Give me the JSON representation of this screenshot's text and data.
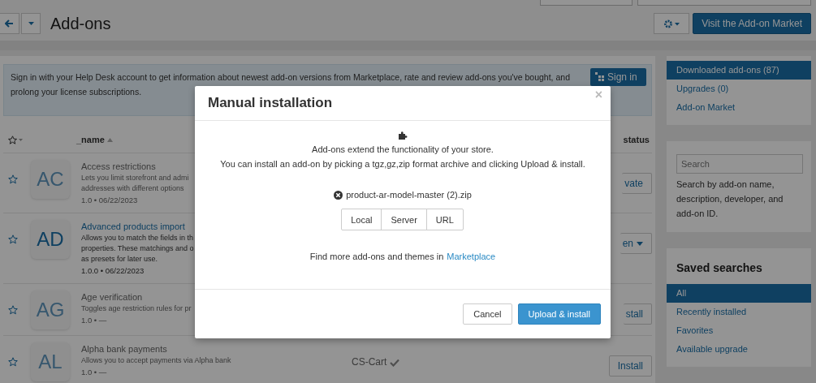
{
  "page": {
    "title": "Add-ons",
    "market_button": "Visit the Add-on Market"
  },
  "notice": {
    "text": "Sign in with your Help Desk account to get information about newest add-on versions from Marketplace, rate and review add-ons you've bought, and prolong your license subscriptions.",
    "button": "Sign in"
  },
  "table": {
    "columns": [
      "_name",
      "status"
    ],
    "rows": [
      {
        "initials": "AC",
        "name": "Access restrictions",
        "enabled": false,
        "description": [
          "Lets you limit storefront and admi",
          "addresses with different options"
        ],
        "meta": "1.0 • 06/22/2023",
        "action": "vate",
        "action_menu": false
      },
      {
        "initials": "AD",
        "name": "Advanced products import",
        "enabled": true,
        "description": [
          "Allows you to match the fields in th",
          "properties. These matchings and o",
          "as presets for later use."
        ],
        "meta": "1.0.0 • 06/22/2023",
        "action": "en",
        "action_menu": true
      },
      {
        "initials": "AG",
        "name": "Age verification",
        "enabled": false,
        "description": [
          "Toggles age restriction rules for pr"
        ],
        "meta": "1.0 • —",
        "action": "stall",
        "action_menu": false
      },
      {
        "initials": "AL",
        "name": "Alpha bank payments",
        "enabled": false,
        "description": [
          "Allows you to accept payments via Alpha bank"
        ],
        "meta": "1.0 • —",
        "developer": "CS-Cart",
        "action": "Install",
        "action_menu": false
      }
    ]
  },
  "sidebar": {
    "views": [
      {
        "label": "Downloaded add-ons (87)",
        "selected": true
      },
      {
        "label": "Upgrades (0)",
        "selected": false
      },
      {
        "label": "Add-on Market",
        "selected": false
      }
    ],
    "search": {
      "placeholder": "Search",
      "help": "Search by add-on name, description, developer, and add-on ID."
    },
    "saved_searches": {
      "title": "Saved searches",
      "items": [
        {
          "label": "All",
          "selected": true
        },
        {
          "label": "Recently installed",
          "selected": false
        },
        {
          "label": "Favorites",
          "selected": false
        },
        {
          "label": "Available upgrade",
          "selected": false
        }
      ]
    }
  },
  "dialog": {
    "title": "Manual installation",
    "close": "×",
    "intro": [
      "Add-ons extend the functionality of your store.",
      "You can install an add-on by picking a tgz,gz,zip format archive and clicking Upload & install."
    ],
    "file": "product-ar-model-master (2).zip",
    "sources": [
      {
        "label": "Local",
        "selected": false
      },
      {
        "label": "Server",
        "selected": false
      },
      {
        "label": "URL",
        "selected": false
      }
    ],
    "more_text": "Find more add-ons and themes in",
    "more_link": "Marketplace",
    "buttons": [
      {
        "label": "Cancel",
        "kind": "secondary"
      },
      {
        "label": "Upload & install",
        "kind": "primary"
      }
    ]
  }
}
